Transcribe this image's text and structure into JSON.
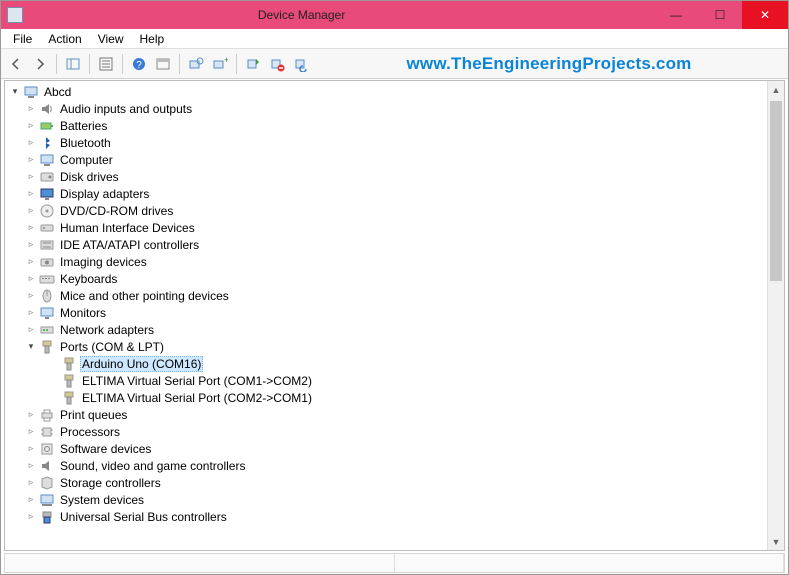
{
  "window": {
    "title": "Device Manager"
  },
  "menu": {
    "items": [
      "File",
      "Action",
      "View",
      "Help"
    ]
  },
  "watermark": "www.TheEngineeringProjects.com",
  "tree": {
    "root": "Abcd",
    "items": [
      {
        "label": "Audio inputs and outputs",
        "icon": "speaker"
      },
      {
        "label": "Batteries",
        "icon": "battery"
      },
      {
        "label": "Bluetooth",
        "icon": "bluetooth"
      },
      {
        "label": "Computer",
        "icon": "computer"
      },
      {
        "label": "Disk drives",
        "icon": "disk"
      },
      {
        "label": "Display adapters",
        "icon": "display"
      },
      {
        "label": "DVD/CD-ROM drives",
        "icon": "cdrom"
      },
      {
        "label": "Human Interface Devices",
        "icon": "hid"
      },
      {
        "label": "IDE ATA/ATAPI controllers",
        "icon": "ide"
      },
      {
        "label": "Imaging devices",
        "icon": "imaging"
      },
      {
        "label": "Keyboards",
        "icon": "keyboard"
      },
      {
        "label": "Mice and other pointing devices",
        "icon": "mouse"
      },
      {
        "label": "Monitors",
        "icon": "monitor"
      },
      {
        "label": "Network adapters",
        "icon": "network"
      },
      {
        "label": "Ports (COM & LPT)",
        "icon": "port",
        "expanded": true,
        "children": [
          {
            "label": "Arduino Uno (COM16)",
            "icon": "port",
            "selected": true
          },
          {
            "label": "ELTIMA Virtual Serial Port (COM1->COM2)",
            "icon": "port"
          },
          {
            "label": "ELTIMA Virtual Serial Port (COM2->COM1)",
            "icon": "port"
          }
        ]
      },
      {
        "label": "Print queues",
        "icon": "printer"
      },
      {
        "label": "Processors",
        "icon": "cpu"
      },
      {
        "label": "Software devices",
        "icon": "software"
      },
      {
        "label": "Sound, video and game controllers",
        "icon": "sound"
      },
      {
        "label": "Storage controllers",
        "icon": "storage"
      },
      {
        "label": "System devices",
        "icon": "system"
      },
      {
        "label": "Universal Serial Bus controllers",
        "icon": "usb"
      }
    ]
  }
}
